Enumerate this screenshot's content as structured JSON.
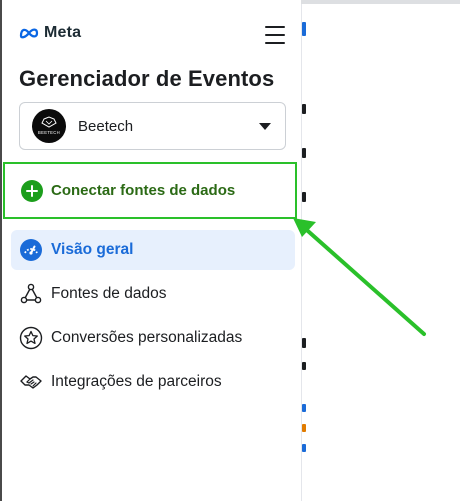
{
  "brand": {
    "logo_text": "Meta",
    "icon": "meta-infinity-icon"
  },
  "header": {
    "menu_icon": "hamburger-menu-icon"
  },
  "title": "Gerenciador de Eventos",
  "account": {
    "name": "Beetech",
    "avatar_text": "BEETECH",
    "caret_icon": "caret-down-icon"
  },
  "connect": {
    "label": "Conectar fontes de dados",
    "icon": "plus-circle-icon"
  },
  "nav": {
    "items": [
      {
        "label": "Visão geral",
        "icon": "speedometer-icon",
        "active": true
      },
      {
        "label": "Fontes de dados",
        "icon": "network-nodes-icon",
        "active": false
      },
      {
        "label": "Conversões personalizadas",
        "icon": "star-badge-icon",
        "active": false
      },
      {
        "label": "Integrações de parceiros",
        "icon": "handshake-icon",
        "active": false
      }
    ]
  },
  "colors": {
    "annotation_green": "#2ac02a",
    "connect_text": "#2b6a15",
    "active_bg": "#e7f0fd",
    "active_text": "#1a6bd8"
  }
}
